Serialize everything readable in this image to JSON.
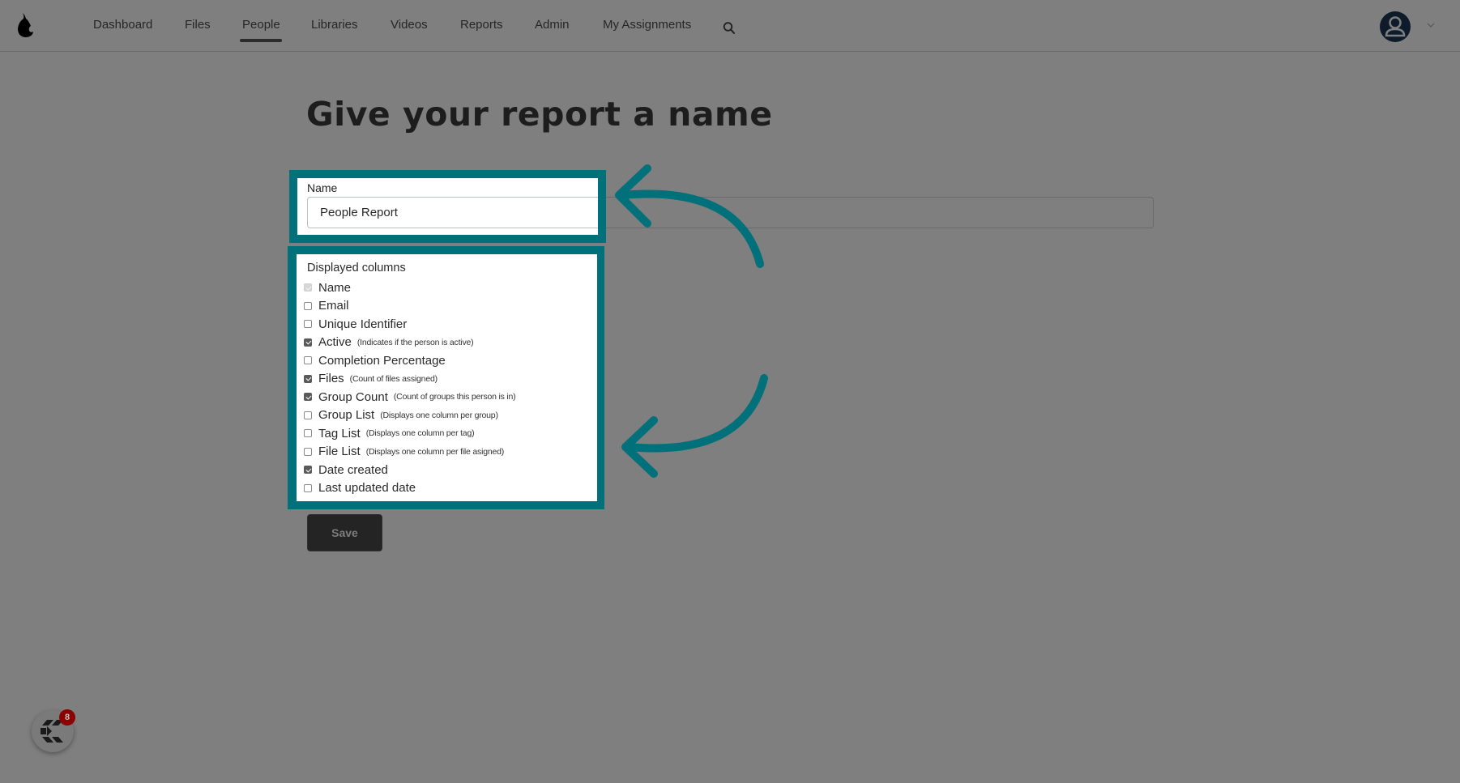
{
  "nav": {
    "items": [
      {
        "label": "Dashboard",
        "active": false
      },
      {
        "label": "Files",
        "active": false
      },
      {
        "label": "People",
        "active": true
      },
      {
        "label": "Libraries",
        "active": false
      },
      {
        "label": "Videos",
        "active": false
      },
      {
        "label": "Reports",
        "active": false
      },
      {
        "label": "Admin",
        "active": false
      },
      {
        "label": "My Assignments",
        "active": false
      }
    ],
    "icons": {
      "logo": "pear-logo",
      "search": "search-icon",
      "avatar": "user-avatar-icon",
      "caret": "chevron-down-icon"
    }
  },
  "page": {
    "title": "Give your report a name",
    "name_field": {
      "label": "Name",
      "value": "People Report"
    },
    "columns": {
      "label": "Displayed columns",
      "items": [
        {
          "name": "Name",
          "description": "",
          "checked": true,
          "disabled": true
        },
        {
          "name": "Email",
          "description": "",
          "checked": false,
          "disabled": false
        },
        {
          "name": "Unique Identifier",
          "description": "",
          "checked": false,
          "disabled": false
        },
        {
          "name": "Active",
          "description": "(Indicates if the person is active)",
          "checked": true,
          "disabled": false
        },
        {
          "name": "Completion Percentage",
          "description": "",
          "checked": false,
          "disabled": false
        },
        {
          "name": "Files",
          "description": "(Count of files assigned)",
          "checked": true,
          "disabled": false
        },
        {
          "name": "Group Count",
          "description": "(Count of groups this person is in)",
          "checked": true,
          "disabled": false
        },
        {
          "name": "Group List",
          "description": "(Displays one column per group)",
          "checked": false,
          "disabled": false
        },
        {
          "name": "Tag List",
          "description": "(Displays one column per tag)",
          "checked": false,
          "disabled": false
        },
        {
          "name": "File List",
          "description": "(Displays one column per file asigned)",
          "checked": false,
          "disabled": false
        },
        {
          "name": "Date created",
          "description": "",
          "checked": true,
          "disabled": false
        },
        {
          "name": "Last updated date",
          "description": "",
          "checked": false,
          "disabled": false
        }
      ]
    },
    "save_label": "Save"
  },
  "annotations": {
    "highlight_color": "#00707a"
  },
  "widget": {
    "badge_count": "8"
  }
}
